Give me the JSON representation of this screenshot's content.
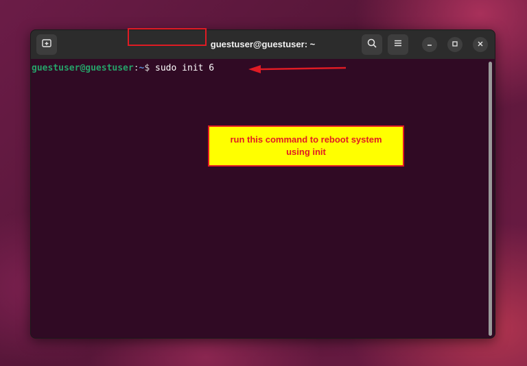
{
  "window": {
    "title": "guestuser@guestuser: ~"
  },
  "toolbar": {
    "new_tab_icon": "new-tab-icon",
    "search_icon": "search-icon",
    "menu_icon": "hamburger-menu-icon"
  },
  "window_controls": {
    "minimize_icon": "minimize-icon",
    "maximize_icon": "maximize-icon",
    "close_icon": "close-icon"
  },
  "terminal": {
    "user_host": "guestuser@guestuser",
    "colon": ":",
    "path": "~",
    "dollar": "$ ",
    "command": "sudo init 6"
  },
  "annotation": {
    "callout_line1": "run this command to reboot system",
    "callout_line2": "using init",
    "color": "#e01b24",
    "callout_bg": "#ffff00"
  },
  "colors": {
    "terminal_bg": "#300a24",
    "titlebar_bg": "#2c2c2c",
    "prompt_green": "#26a269"
  }
}
